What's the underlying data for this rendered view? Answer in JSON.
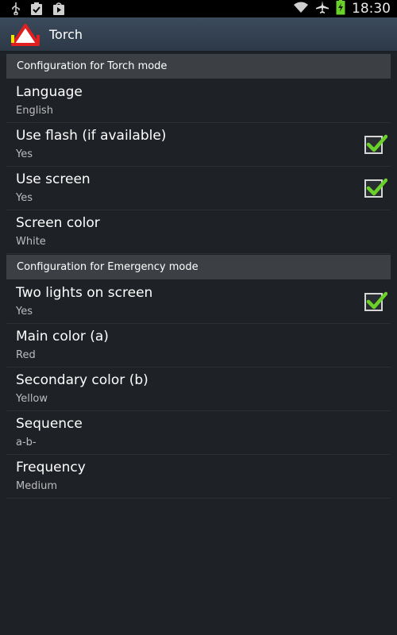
{
  "status_bar": {
    "time": "18:30",
    "left_icons": [
      "usb-icon",
      "clipboard-check-icon",
      "play-store-icon"
    ],
    "right_icons": [
      "wifi-icon",
      "airplane-mode-icon",
      "battery-charging-icon"
    ]
  },
  "action_bar": {
    "title": "Torch",
    "icon": "warning-triangle-icon"
  },
  "sections": [
    {
      "header": "Configuration for Torch mode",
      "items": [
        {
          "title": "Language",
          "summary": "English",
          "checkbox": null
        },
        {
          "title": "Use flash (if available)",
          "summary": "Yes",
          "checkbox": true
        },
        {
          "title": "Use screen",
          "summary": "Yes",
          "checkbox": true
        },
        {
          "title": "Screen color",
          "summary": "White",
          "checkbox": null
        }
      ]
    },
    {
      "header": "Configuration for Emergency mode",
      "items": [
        {
          "title": "Two lights on screen",
          "summary": "Yes",
          "checkbox": true
        },
        {
          "title": "Main color (a)",
          "summary": "Red",
          "checkbox": null
        },
        {
          "title": "Secondary color (b)",
          "summary": "Yellow",
          "checkbox": null
        },
        {
          "title": "Sequence",
          "summary": "a-b-",
          "checkbox": null
        },
        {
          "title": "Frequency",
          "summary": "Medium",
          "checkbox": null
        }
      ]
    }
  ],
  "colors": {
    "background": "#1e2126",
    "action_bar": "#34414f",
    "section_header": "#3c4045",
    "check_accent": "#6ad12a"
  }
}
